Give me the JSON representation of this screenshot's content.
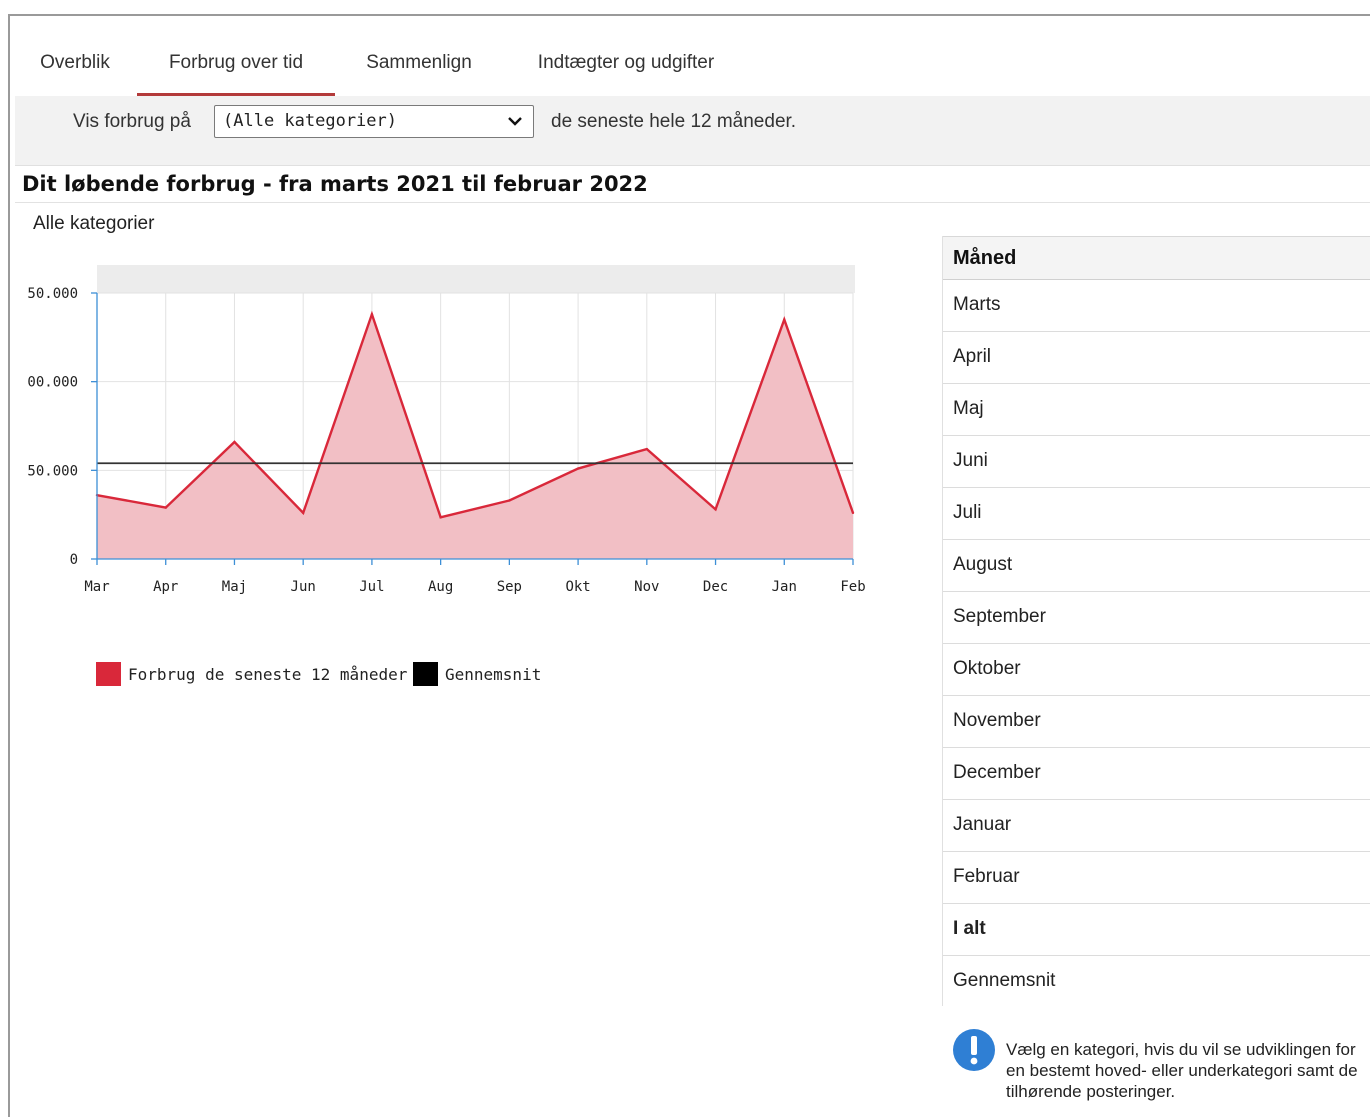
{
  "tabs": [
    {
      "label": "Overblik",
      "active": false
    },
    {
      "label": "Forbrug over tid",
      "active": true
    },
    {
      "label": "Sammenlign",
      "active": false
    },
    {
      "label": "Indtægter og udgifter",
      "active": false
    }
  ],
  "filter": {
    "prefix": "Vis forbrug på",
    "selected": "(Alle kategorier)",
    "suffix": "de seneste hele 12 måneder."
  },
  "title": "Dit løbende forbrug - fra marts 2021 til februar 2022",
  "subtitle": "Alle kategorier",
  "chart_data": {
    "type": "area",
    "title": "",
    "xlabel": "",
    "ylabel": "",
    "categories": [
      "Mar",
      "Apr",
      "Maj",
      "Jun",
      "Jul",
      "Aug",
      "Sep",
      "Okt",
      "Nov",
      "Dec",
      "Jan",
      "Feb"
    ],
    "series": [
      {
        "name": "Forbrug de seneste 12 måneder",
        "color": "#d9283a",
        "fill": "#f2bfc5",
        "values": [
          36000,
          29000,
          66000,
          26000,
          138000,
          23500,
          33000,
          51000,
          62000,
          28000,
          135000,
          26000
        ]
      },
      {
        "name": "Gennemsnit",
        "color": "#333333",
        "values": [
          54000,
          54000,
          54000,
          54000,
          54000,
          54000,
          54000,
          54000,
          54000,
          54000,
          54000,
          54000
        ]
      }
    ],
    "yticks": [
      0,
      50000,
      100000,
      150000
    ],
    "ytick_labels": [
      "0",
      "50.000",
      "00.000",
      "50.000"
    ],
    "ylim": [
      0,
      150000
    ],
    "grid": true,
    "legend_position": "bottom-left"
  },
  "legend": [
    {
      "label": "Forbrug de seneste 12 måneder",
      "color": "#d9283a"
    },
    {
      "label": "Gennemsnit",
      "color": "#000000"
    }
  ],
  "table": {
    "header": "Måned",
    "rows": [
      "Marts",
      "April",
      "Maj",
      "Juni",
      "Juli",
      "August",
      "September",
      "Oktober",
      "November",
      "December",
      "Januar",
      "Februar",
      "I alt",
      "Gennemsnit"
    ]
  },
  "info": {
    "icon": "info-exclamation-icon",
    "text": "Vælg en kategori, hvis du vil se udviklingen for en bestemt hoved- eller underkategori samt de tilhørende posteringer."
  }
}
